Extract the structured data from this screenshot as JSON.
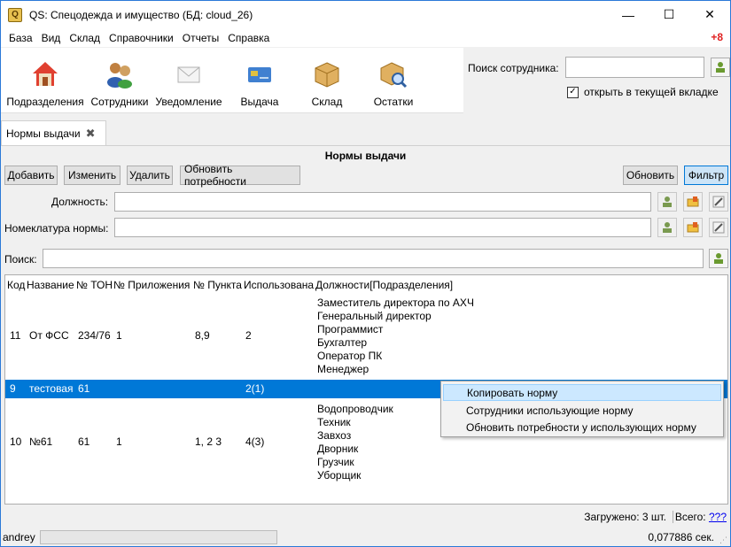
{
  "window": {
    "title": "QS: Спецодежда и имущество (БД: cloud_26)",
    "controls": {
      "minimize": "—",
      "maximize": "☐",
      "close": "✕"
    }
  },
  "menu": {
    "items": [
      "База",
      "Вид",
      "Склад",
      "Справочники",
      "Отчеты",
      "Справка"
    ],
    "badge": "+8"
  },
  "toolbar": {
    "items": [
      {
        "label": "Подразделения",
        "icon": "house-icon"
      },
      {
        "label": "Сотрудники",
        "icon": "people-icon"
      },
      {
        "label": "Уведомление",
        "icon": "envelope-icon"
      },
      {
        "label": "Выдача",
        "icon": "card-icon"
      },
      {
        "label": "Склад",
        "icon": "box-icon"
      },
      {
        "label": "Остатки",
        "icon": "magnifier-box-icon"
      }
    ]
  },
  "employee_search": {
    "label": "Поиск сотрудника:",
    "value": "",
    "checkbox_label": "открыть в текущей вкладке",
    "checked": true
  },
  "tab": {
    "label": "Нормы выдачи",
    "close": "✖"
  },
  "content": {
    "title": "Нормы выдачи",
    "buttons": {
      "add": "Добавить",
      "edit": "Изменить",
      "delete": "Удалить",
      "update_needs": "Обновить потребности",
      "refresh": "Обновить",
      "filter": "Фильтр"
    },
    "fields": {
      "position_label": "Должность:",
      "position_value": "",
      "nomenclature_label": "Номеклатура нормы:",
      "nomenclature_value": "",
      "search_label": "Поиск:",
      "search_value": ""
    }
  },
  "table": {
    "headers": [
      "Код",
      "Название",
      "№ ТОН",
      "№ Приложения",
      "№ Пункта",
      "Использована",
      "Должности[Подразделения]"
    ],
    "rows": [
      {
        "code": "11",
        "name": "От ФСС",
        "ton": "234/76",
        "appendix": "1",
        "point": "8,9",
        "used": "2",
        "positions": [
          "Заместитель директора по АХЧ",
          "Генеральный директор",
          "Программист",
          "Бухгалтер",
          "Оператор ПК",
          "Менеджер"
        ]
      },
      {
        "code": "9",
        "name": "тестовая",
        "ton": "61",
        "appendix": "",
        "point": "",
        "used": "2(1)",
        "positions": [],
        "selected": true
      },
      {
        "code": "10",
        "name": "№61",
        "ton": "61",
        "appendix": "1",
        "point": "1, 2 3",
        "used": "4(3)",
        "positions": [
          "Водопроводчик",
          "Техник",
          "Завхоз",
          "Дворник",
          "Грузчик",
          "Уборщик"
        ]
      }
    ]
  },
  "context_menu": {
    "items": [
      "Копировать норму",
      "Сотрудники использующие норму",
      "Обновить потребности у использующих норму"
    ]
  },
  "footer": {
    "loaded": "Загружено: 3 шт.",
    "total_label": "Всего:",
    "total_value": "???"
  },
  "status": {
    "user": "andrey",
    "time": "0,077886 сек."
  },
  "colors": {
    "selection": "#0078d7",
    "accent_border": "#0078d7",
    "badge": "#e02020"
  }
}
